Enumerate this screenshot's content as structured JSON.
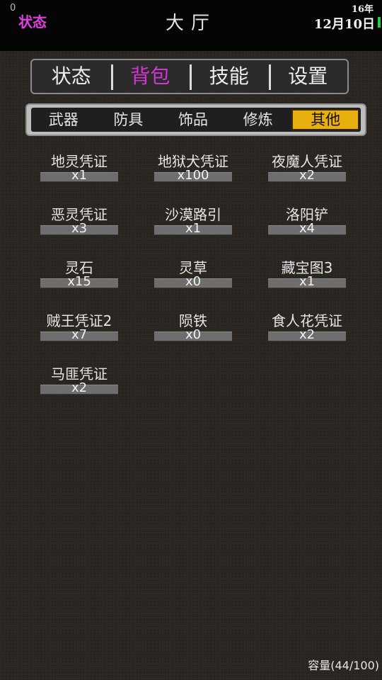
{
  "topbar": {
    "counter": "0",
    "status_label": "状态",
    "title": "大厅",
    "year": "16年",
    "date": "12月10日"
  },
  "main_tabs": [
    {
      "label": "状态",
      "active": false
    },
    {
      "label": "背包",
      "active": true
    },
    {
      "label": "技能",
      "active": false
    },
    {
      "label": "设置",
      "active": false
    }
  ],
  "sub_tabs": [
    {
      "label": "武器",
      "active": false
    },
    {
      "label": "防具",
      "active": false
    },
    {
      "label": "饰品",
      "active": false
    },
    {
      "label": "修炼",
      "active": false
    },
    {
      "label": "其他",
      "active": true
    }
  ],
  "items": [
    {
      "name": "地灵凭证",
      "count": "x1"
    },
    {
      "name": "地狱犬凭证",
      "count": "x100"
    },
    {
      "name": "夜魔人凭证",
      "count": "x2"
    },
    {
      "name": "恶灵凭证",
      "count": "x3"
    },
    {
      "name": "沙漠路引",
      "count": "x1"
    },
    {
      "name": "洛阳铲",
      "count": "x4"
    },
    {
      "name": "灵石",
      "count": "x15"
    },
    {
      "name": "灵草",
      "count": "x0"
    },
    {
      "name": "藏宝图3",
      "count": "x1"
    },
    {
      "name": "贼王凭证2",
      "count": "x7"
    },
    {
      "name": "陨铁",
      "count": "x0"
    },
    {
      "name": "食人花凭证",
      "count": "x2"
    },
    {
      "name": "马匪凭证",
      "count": "x2"
    }
  ],
  "capacity": "容量(44/100)",
  "colors": {
    "active_main_tab": "#d633d6",
    "active_sub_tab_bg": "#e8b00f",
    "status_label": "#e040e0",
    "signal_bar": "#22cc44"
  }
}
